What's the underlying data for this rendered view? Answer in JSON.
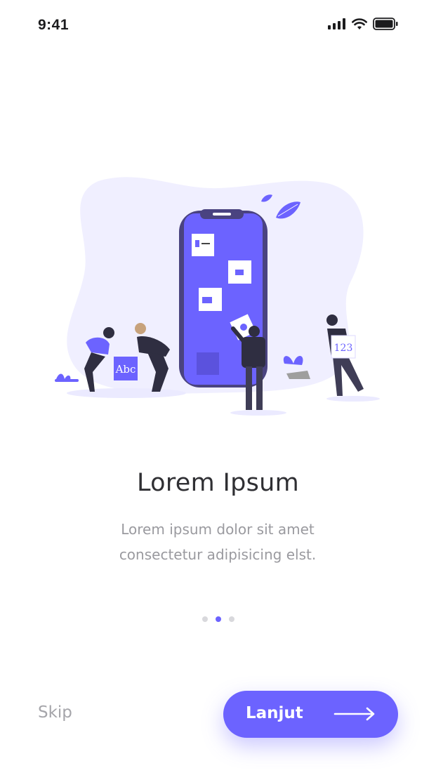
{
  "status_bar": {
    "time": "9:41",
    "icons": [
      "signal-icon",
      "wifi-icon",
      "battery-icon"
    ]
  },
  "illustration": {
    "name": "onboarding-illustration",
    "box_left_label": "Abc",
    "box_right_label": "123"
  },
  "content": {
    "title": "Lorem Ipsum",
    "subtitle": "Lorem ipsum dolor sit amet consectetur adipisicing elst."
  },
  "pagination": {
    "total": 3,
    "active_index": 1
  },
  "actions": {
    "skip_label": "Skip",
    "next_label": "Lanjut",
    "next_icon": "arrow-right-icon"
  },
  "colors": {
    "accent": "#6c63ff",
    "blob": "#f0efff",
    "title": "#2f2f33",
    "subtitle": "#9a9a9f"
  }
}
